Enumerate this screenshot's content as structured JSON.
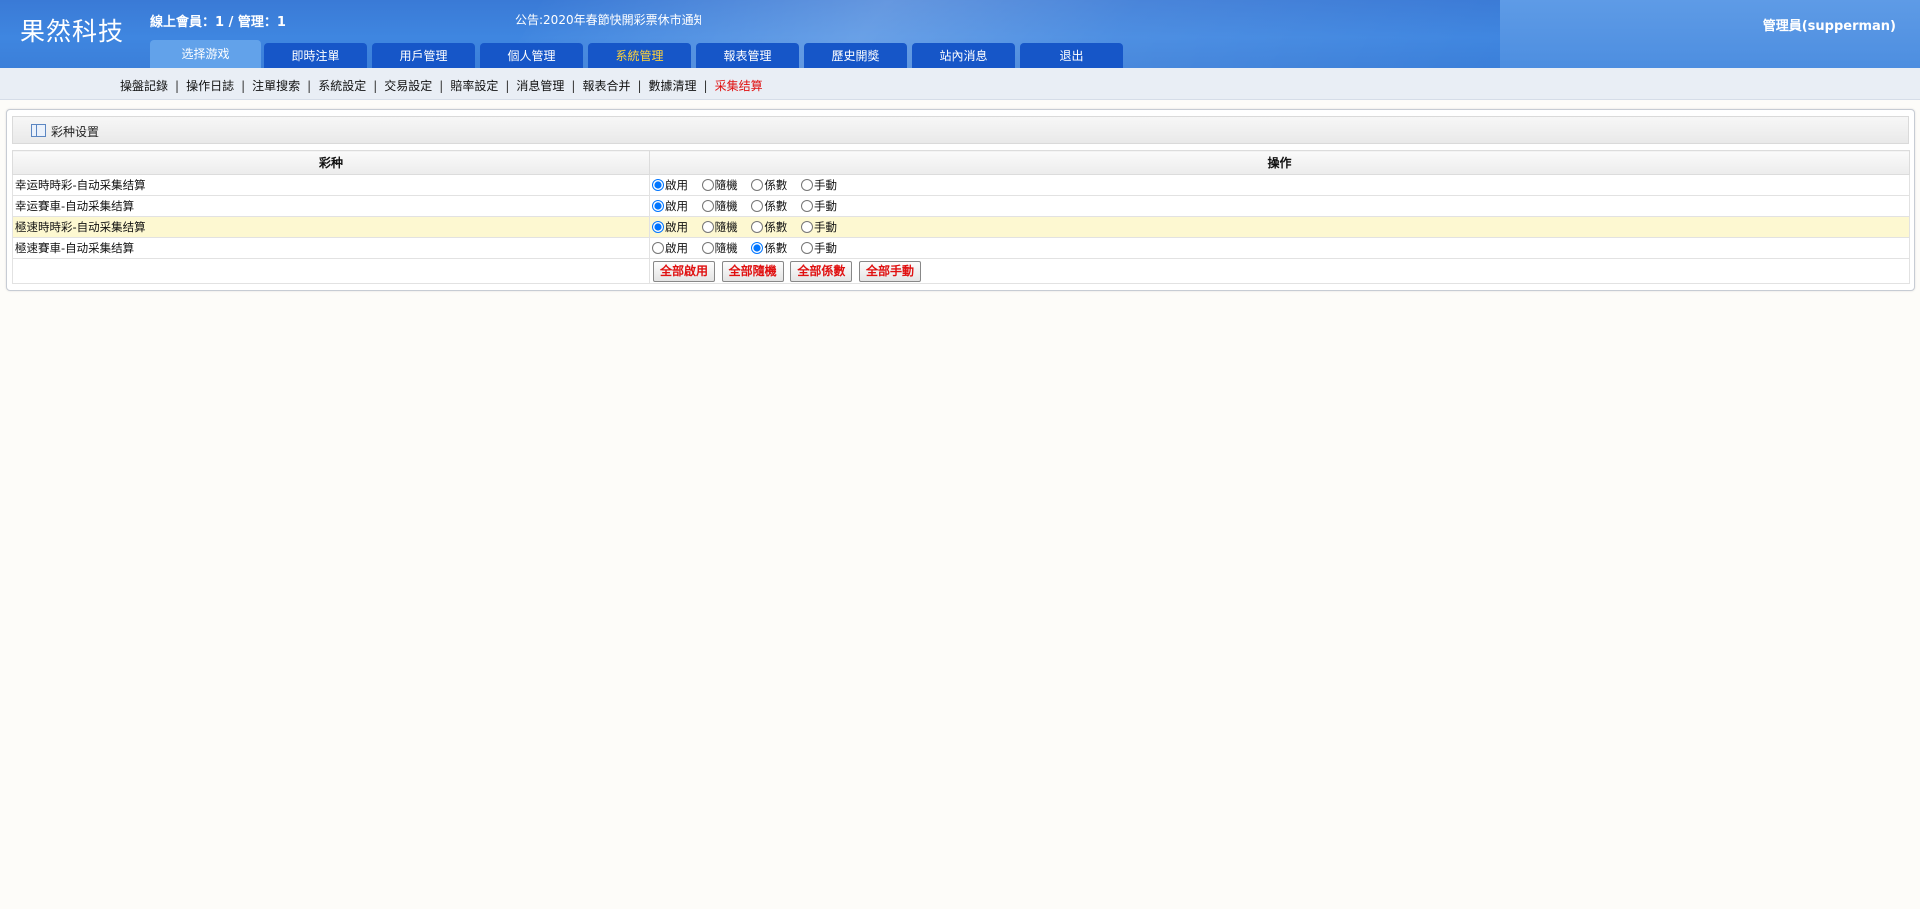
{
  "header": {
    "logo": "果然科技",
    "online_text": "線上會員：1 / 管理：1",
    "notice": "公告:2020年春節快開彩票休市通知",
    "admin": "管理員(supperman)"
  },
  "nav": {
    "tabs": [
      {
        "label": "选择游戏"
      },
      {
        "label": "即時注單"
      },
      {
        "label": "用戶管理"
      },
      {
        "label": "個人管理"
      },
      {
        "label": "系統管理"
      },
      {
        "label": "報表管理"
      },
      {
        "label": "歷史開獎"
      },
      {
        "label": "站內消息"
      },
      {
        "label": "退出"
      }
    ],
    "active_label": "系統管理"
  },
  "subnav": {
    "items": [
      "操盤記錄",
      "操作日誌",
      "注單搜索",
      "系統設定",
      "交易設定",
      "賠率設定",
      "消息管理",
      "報表合并",
      "數據清理",
      "采集结算"
    ],
    "current": "采集结算"
  },
  "panel": {
    "title": "彩种设置",
    "columns": [
      "彩种",
      "操作"
    ],
    "option_labels": [
      "啟用",
      "隨機",
      "係數",
      "手動"
    ],
    "rows": [
      {
        "name": "幸运時時彩-自动采集结算",
        "selected": "啟用"
      },
      {
        "name": "幸运賽車-自动采集结算",
        "selected": "啟用"
      },
      {
        "name": "極速時時彩-自动采集结算",
        "selected": "啟用"
      },
      {
        "name": "極速賽車-自动采集结算",
        "selected": "係數"
      }
    ],
    "buttons": [
      "全部啟用",
      "全部隨機",
      "全部係數",
      "全部手動"
    ]
  },
  "colors": {
    "header_blue": "#3f86e0",
    "tab_blue": "#1656c8",
    "tab_selected": "#62a2ea",
    "active_tab_text": "#ffd23a",
    "current_subnav": "#e01010",
    "highlight_row": "#fdf8d1"
  },
  "icons": {
    "panel_icon": "table-icon"
  }
}
